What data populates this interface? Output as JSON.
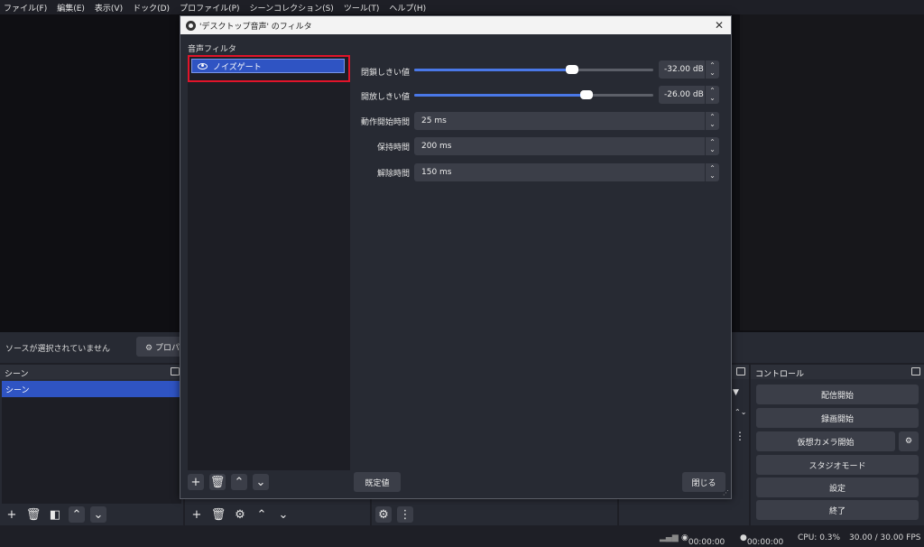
{
  "menu": [
    "ファイル(F)",
    "編集(E)",
    "表示(V)",
    "ドック(D)",
    "プロファイル(P)",
    "シーンコレクション(S)",
    "ツール(T)",
    "ヘルプ(H)"
  ],
  "source_bar": {
    "no_source": "ソースが選択されていません",
    "properties": "プロパテ"
  },
  "scenes": {
    "title": "シーン",
    "items": [
      "シーン"
    ]
  },
  "controls": {
    "title": "コントロール",
    "buttons": [
      "配信開始",
      "録画開始",
      "仮想カメラ開始",
      "スタジオモード",
      "設定",
      "終了"
    ]
  },
  "status": {
    "stream_time": "00:00:00",
    "rec_time": "00:00:00",
    "cpu": "CPU: 0.3%",
    "fps": "30.00 / 30.00 FPS"
  },
  "dialog": {
    "title": "'デスクトップ音声' のフィルタ",
    "filters_label": "音声フィルタ",
    "filter_items": [
      {
        "name": "ノイズゲート",
        "visible": true
      }
    ],
    "props": {
      "close_threshold": {
        "label": "閉鎖しきい値",
        "value": "-32.00 dB",
        "level": 0.66
      },
      "open_threshold": {
        "label": "開放しきい値",
        "value": "-26.00 dB",
        "level": 0.72
      },
      "attack": {
        "label": "動作開始時間",
        "value": "25 ms"
      },
      "hold": {
        "label": "保持時間",
        "value": "200 ms"
      },
      "release": {
        "label": "解除時間",
        "value": "150 ms"
      }
    },
    "defaults_button": "既定値",
    "close_button": "閉じる"
  },
  "colors": {
    "accent": "#2f54c3",
    "slider": "#4a78e8",
    "highlight": "#e0142a"
  }
}
